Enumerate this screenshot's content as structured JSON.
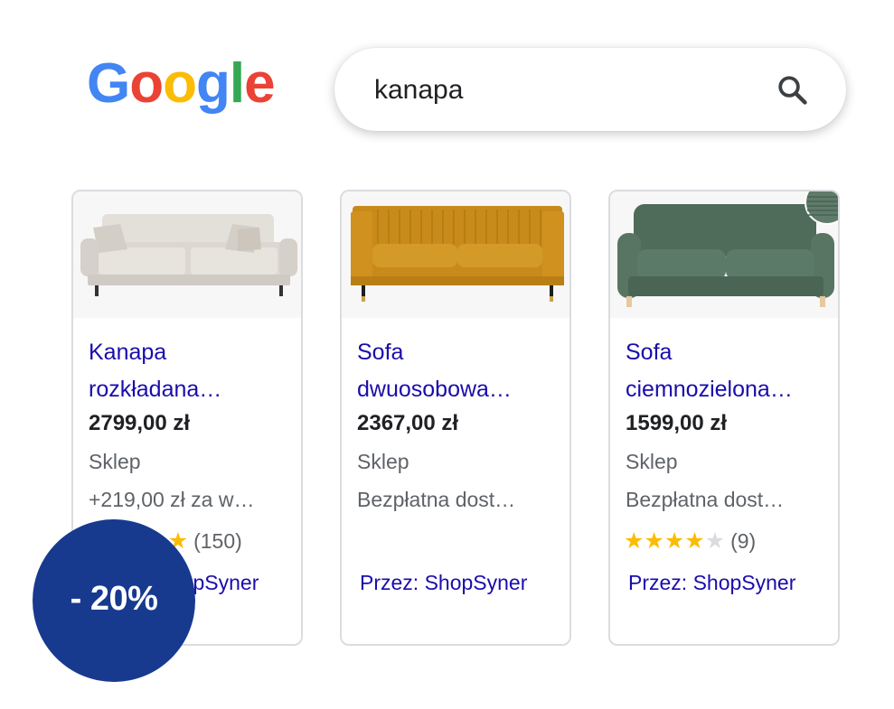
{
  "logo": {
    "letters": [
      {
        "char": "G",
        "color": "#4285F4"
      },
      {
        "char": "o",
        "color": "#EA4335"
      },
      {
        "char": "o",
        "color": "#FBBC05"
      },
      {
        "char": "g",
        "color": "#4285F4"
      },
      {
        "char": "l",
        "color": "#34A853"
      },
      {
        "char": "e",
        "color": "#EA4335"
      }
    ]
  },
  "search": {
    "query": "kanapa",
    "icon": "search-icon"
  },
  "products": [
    {
      "title_line1": "Kanapa",
      "title_line2": "rozkładana…",
      "price": "2799,00 zł",
      "shop": "Sklep",
      "detail": "+219,00 zł za w…",
      "rating": 5,
      "reviews": "(150)",
      "seller": "Przez: ShopSyner",
      "image": "beige-sofa"
    },
    {
      "title_line1": "Sofa",
      "title_line2": "dwuosobowa…",
      "price": "2367,00 zł",
      "shop": "Sklep",
      "detail": "Bezpłatna dost…",
      "seller": "Przez: ShopSyner",
      "image": "mustard-sofa"
    },
    {
      "title_line1": "Sofa",
      "title_line2": "ciemnozielona…",
      "price": "1599,00 zł",
      "shop": "Sklep",
      "detail": "Bezpłatna dost…",
      "rating": 4,
      "reviews": "(9)",
      "seller": "Przez: ShopSyner",
      "image": "green-sofa"
    }
  ],
  "badge": {
    "label": "- 20%",
    "color": "#173a8f"
  },
  "colors": {
    "link": "#1a0dab",
    "star": "#fbbc04",
    "star_empty": "#dadce0"
  }
}
